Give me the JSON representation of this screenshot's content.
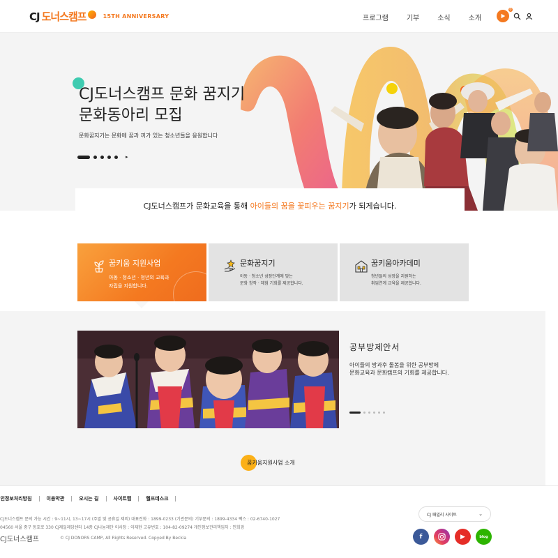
{
  "header": {
    "logo_cj": "CJ",
    "logo_name": "도너스캠프",
    "logo_anniversary": "15TH ANNIVERSARY",
    "nav": [
      "프로그램",
      "기부",
      "소식",
      "소개"
    ],
    "badge_count": "0"
  },
  "hero": {
    "title_line1": "CJ도너스캠프 문화 꿈지기",
    "title_line2": "문화동아리 모집",
    "subtitle": "문화꿈지기는 문화에 꿈과 끼가 있는 청소년들을 응원합니다",
    "slide_arrow": "▸"
  },
  "intro": {
    "prefix": "CJ도너스캠프가 문화교육을 통해 ",
    "highlight": "아이들의 꿈을 꽃피우는 꿈지기",
    "suffix": "가 되게습니다."
  },
  "cards": [
    {
      "title": "꿈키움 지원사업",
      "desc_line1": "아동 · 청소년 · 청년의 교육과",
      "desc_line2": "자립을 지원합니다."
    },
    {
      "title": "문화꿈지기",
      "desc_line1": "아동 · 청소년 성장단계에 맞는",
      "desc_line2": "문화 창작 · 체험 기회를 제공합니다."
    },
    {
      "title": "꿈키움아카데미",
      "desc_line1": "청년들의 성장을 지원하는",
      "desc_line2": "취업연계 교육을 제공합니다."
    }
  ],
  "program": {
    "title": "공부방제안서",
    "desc_line1": "아이들의 방과후 돌봄을 위한 공부방에",
    "desc_line2": "문화교육과 문화캠프의 기회를 제공합니다.",
    "cta": "꿈키움지원사업 소개"
  },
  "footer": {
    "links": [
      "개인정보처리방침",
      "이용약관",
      "오시는 길",
      "사이트맵",
      "헬프데스크"
    ],
    "info_line1": "CJ도너스캠프 문의 가능 시간 : 9~11시, 13~17시 (주말 및 공휴일 제외) 대표전화 : 1899-0233 (기관문의) 기부문의 : 1899-4334 팩스 : 02-6740-1027",
    "info_line2": "04560 서울 중구 동호로 330 CJ제일제당센터 14층 CJ나눔재단 이사장 : 이재현 고유번호 : 104-82-09274 개인정보관리책임자 : 민희경",
    "logo": "CJ도너스캠프",
    "copyright": "© CJ DONORS CAMP, All Rights Reserved. Copyed By Beckia",
    "family_site": "CJ 패밀리 사이트",
    "family_chevron": "⌄",
    "social": [
      "f",
      "ig",
      "▶",
      "blog"
    ]
  },
  "colors": {
    "accent": "#f47920",
    "mint": "#3ecbb0",
    "card_bg": "#e3e3e3",
    "section_bg": "#f4f4f4"
  }
}
